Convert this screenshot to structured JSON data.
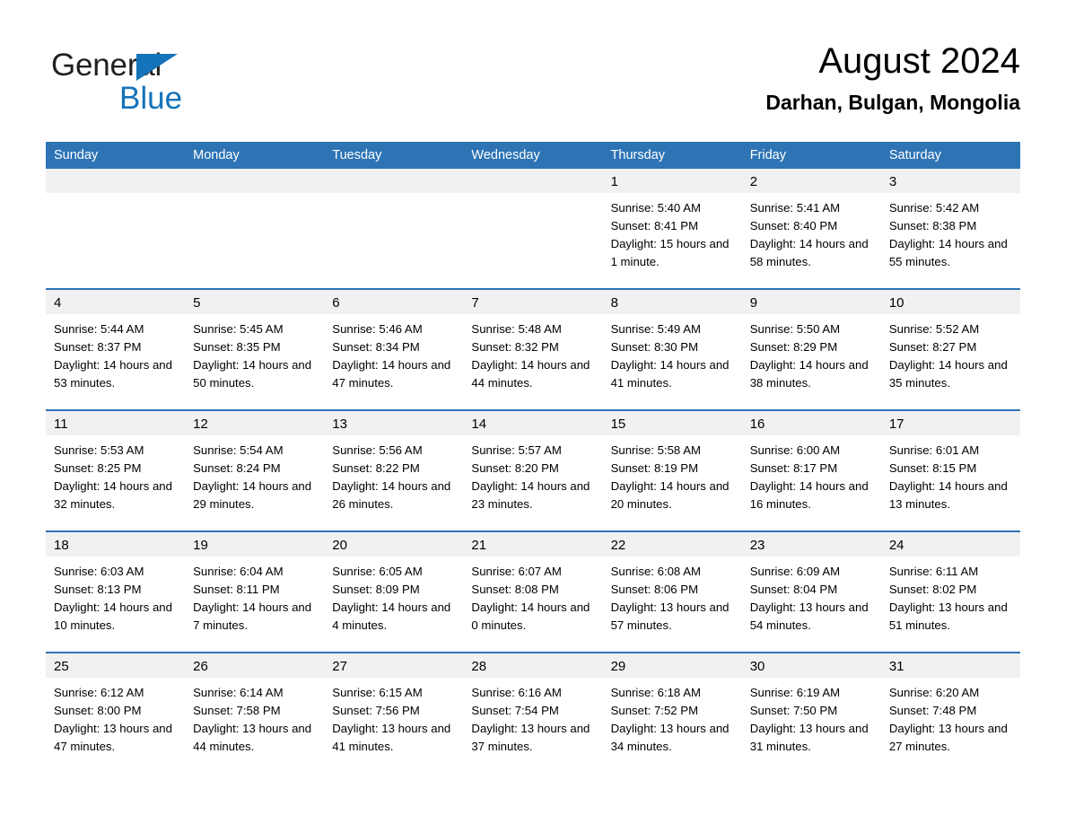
{
  "brand": {
    "logo_text_1": "General",
    "logo_text_2": "Blue",
    "accent_color": "#1473BA"
  },
  "header": {
    "title": "August 2024",
    "subtitle": "Darhan, Bulgan, Mongolia",
    "header_bg_color": "#2E74B5",
    "daynum_bg_color": "#F1F1F1"
  },
  "weekday_headers": [
    "Sunday",
    "Monday",
    "Tuesday",
    "Wednesday",
    "Thursday",
    "Friday",
    "Saturday"
  ],
  "weeks": [
    [
      {
        "day": "",
        "sunrise": "",
        "sunset": "",
        "daylight": "",
        "empty": true
      },
      {
        "day": "",
        "sunrise": "",
        "sunset": "",
        "daylight": "",
        "empty": true
      },
      {
        "day": "",
        "sunrise": "",
        "sunset": "",
        "daylight": "",
        "empty": true
      },
      {
        "day": "",
        "sunrise": "",
        "sunset": "",
        "daylight": "",
        "empty": true
      },
      {
        "day": "1",
        "sunrise": "Sunrise: 5:40 AM",
        "sunset": "Sunset: 8:41 PM",
        "daylight": "Daylight: 15 hours and 1 minute."
      },
      {
        "day": "2",
        "sunrise": "Sunrise: 5:41 AM",
        "sunset": "Sunset: 8:40 PM",
        "daylight": "Daylight: 14 hours and 58 minutes."
      },
      {
        "day": "3",
        "sunrise": "Sunrise: 5:42 AM",
        "sunset": "Sunset: 8:38 PM",
        "daylight": "Daylight: 14 hours and 55 minutes."
      }
    ],
    [
      {
        "day": "4",
        "sunrise": "Sunrise: 5:44 AM",
        "sunset": "Sunset: 8:37 PM",
        "daylight": "Daylight: 14 hours and 53 minutes."
      },
      {
        "day": "5",
        "sunrise": "Sunrise: 5:45 AM",
        "sunset": "Sunset: 8:35 PM",
        "daylight": "Daylight: 14 hours and 50 minutes."
      },
      {
        "day": "6",
        "sunrise": "Sunrise: 5:46 AM",
        "sunset": "Sunset: 8:34 PM",
        "daylight": "Daylight: 14 hours and 47 minutes."
      },
      {
        "day": "7",
        "sunrise": "Sunrise: 5:48 AM",
        "sunset": "Sunset: 8:32 PM",
        "daylight": "Daylight: 14 hours and 44 minutes."
      },
      {
        "day": "8",
        "sunrise": "Sunrise: 5:49 AM",
        "sunset": "Sunset: 8:30 PM",
        "daylight": "Daylight: 14 hours and 41 minutes."
      },
      {
        "day": "9",
        "sunrise": "Sunrise: 5:50 AM",
        "sunset": "Sunset: 8:29 PM",
        "daylight": "Daylight: 14 hours and 38 minutes."
      },
      {
        "day": "10",
        "sunrise": "Sunrise: 5:52 AM",
        "sunset": "Sunset: 8:27 PM",
        "daylight": "Daylight: 14 hours and 35 minutes."
      }
    ],
    [
      {
        "day": "11",
        "sunrise": "Sunrise: 5:53 AM",
        "sunset": "Sunset: 8:25 PM",
        "daylight": "Daylight: 14 hours and 32 minutes."
      },
      {
        "day": "12",
        "sunrise": "Sunrise: 5:54 AM",
        "sunset": "Sunset: 8:24 PM",
        "daylight": "Daylight: 14 hours and 29 minutes."
      },
      {
        "day": "13",
        "sunrise": "Sunrise: 5:56 AM",
        "sunset": "Sunset: 8:22 PM",
        "daylight": "Daylight: 14 hours and 26 minutes."
      },
      {
        "day": "14",
        "sunrise": "Sunrise: 5:57 AM",
        "sunset": "Sunset: 8:20 PM",
        "daylight": "Daylight: 14 hours and 23 minutes."
      },
      {
        "day": "15",
        "sunrise": "Sunrise: 5:58 AM",
        "sunset": "Sunset: 8:19 PM",
        "daylight": "Daylight: 14 hours and 20 minutes."
      },
      {
        "day": "16",
        "sunrise": "Sunrise: 6:00 AM",
        "sunset": "Sunset: 8:17 PM",
        "daylight": "Daylight: 14 hours and 16 minutes."
      },
      {
        "day": "17",
        "sunrise": "Sunrise: 6:01 AM",
        "sunset": "Sunset: 8:15 PM",
        "daylight": "Daylight: 14 hours and 13 minutes."
      }
    ],
    [
      {
        "day": "18",
        "sunrise": "Sunrise: 6:03 AM",
        "sunset": "Sunset: 8:13 PM",
        "daylight": "Daylight: 14 hours and 10 minutes."
      },
      {
        "day": "19",
        "sunrise": "Sunrise: 6:04 AM",
        "sunset": "Sunset: 8:11 PM",
        "daylight": "Daylight: 14 hours and 7 minutes."
      },
      {
        "day": "20",
        "sunrise": "Sunrise: 6:05 AM",
        "sunset": "Sunset: 8:09 PM",
        "daylight": "Daylight: 14 hours and 4 minutes."
      },
      {
        "day": "21",
        "sunrise": "Sunrise: 6:07 AM",
        "sunset": "Sunset: 8:08 PM",
        "daylight": "Daylight: 14 hours and 0 minutes."
      },
      {
        "day": "22",
        "sunrise": "Sunrise: 6:08 AM",
        "sunset": "Sunset: 8:06 PM",
        "daylight": "Daylight: 13 hours and 57 minutes."
      },
      {
        "day": "23",
        "sunrise": "Sunrise: 6:09 AM",
        "sunset": "Sunset: 8:04 PM",
        "daylight": "Daylight: 13 hours and 54 minutes."
      },
      {
        "day": "24",
        "sunrise": "Sunrise: 6:11 AM",
        "sunset": "Sunset: 8:02 PM",
        "daylight": "Daylight: 13 hours and 51 minutes."
      }
    ],
    [
      {
        "day": "25",
        "sunrise": "Sunrise: 6:12 AM",
        "sunset": "Sunset: 8:00 PM",
        "daylight": "Daylight: 13 hours and 47 minutes."
      },
      {
        "day": "26",
        "sunrise": "Sunrise: 6:14 AM",
        "sunset": "Sunset: 7:58 PM",
        "daylight": "Daylight: 13 hours and 44 minutes."
      },
      {
        "day": "27",
        "sunrise": "Sunrise: 6:15 AM",
        "sunset": "Sunset: 7:56 PM",
        "daylight": "Daylight: 13 hours and 41 minutes."
      },
      {
        "day": "28",
        "sunrise": "Sunrise: 6:16 AM",
        "sunset": "Sunset: 7:54 PM",
        "daylight": "Daylight: 13 hours and 37 minutes."
      },
      {
        "day": "29",
        "sunrise": "Sunrise: 6:18 AM",
        "sunset": "Sunset: 7:52 PM",
        "daylight": "Daylight: 13 hours and 34 minutes."
      },
      {
        "day": "30",
        "sunrise": "Sunrise: 6:19 AM",
        "sunset": "Sunset: 7:50 PM",
        "daylight": "Daylight: 13 hours and 31 minutes."
      },
      {
        "day": "31",
        "sunrise": "Sunrise: 6:20 AM",
        "sunset": "Sunset: 7:48 PM",
        "daylight": "Daylight: 13 hours and 27 minutes."
      }
    ]
  ]
}
